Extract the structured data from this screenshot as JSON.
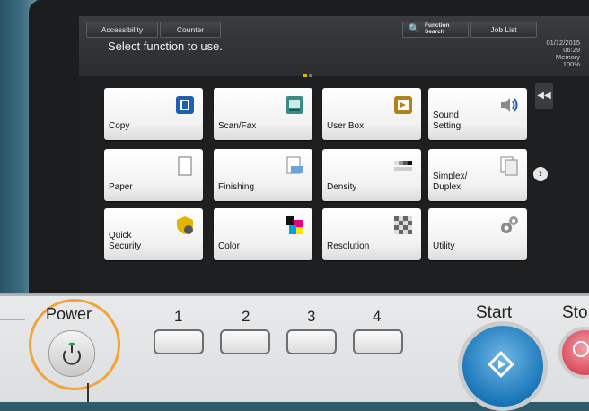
{
  "statusbar": {
    "accessibility": "Accessibility",
    "counter": "Counter",
    "function_search": "Function\nSearch",
    "job_list": "Job List",
    "message": "Select function to use.",
    "date": "01/12/2015",
    "time": "06:29",
    "memory_label": "Memory",
    "memory_value": "100%"
  },
  "tiles": [
    {
      "label": "Copy",
      "icon": "copy-icon"
    },
    {
      "label": "Scan/Fax",
      "icon": "scan-fax-icon"
    },
    {
      "label": "User Box",
      "icon": "user-box-icon"
    },
    {
      "label": "Sound\nSetting",
      "icon": "speaker-icon"
    },
    {
      "label": "Paper",
      "icon": "paper-icon"
    },
    {
      "label": "Finishing",
      "icon": "finishing-icon"
    },
    {
      "label": "Density",
      "icon": "density-icon"
    },
    {
      "label": "Simplex/\nDuplex",
      "icon": "duplex-icon"
    },
    {
      "label": "Quick\nSecurity",
      "icon": "shield-icon"
    },
    {
      "label": "Color",
      "icon": "color-icon"
    },
    {
      "label": "Resolution",
      "icon": "resolution-icon"
    },
    {
      "label": "Utility",
      "icon": "gear-icon"
    }
  ],
  "panel": {
    "power": "Power",
    "keys": [
      "1",
      "2",
      "3",
      "4"
    ],
    "start": "Start",
    "stop": "Sto"
  },
  "colors": {
    "accent_orange": "#f2a43b",
    "start_blue": "#1976b8",
    "stop_red": "#d9485a"
  }
}
